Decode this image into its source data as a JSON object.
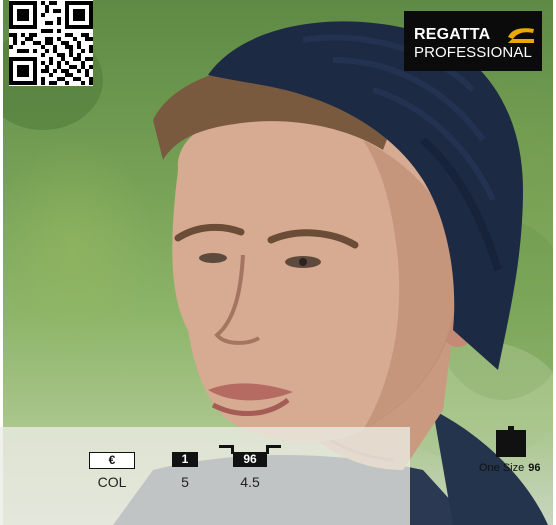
{
  "brand": {
    "line1": "REGATTA",
    "line2": "PROFESSIONAL",
    "swoosh_color": "#e8a900"
  },
  "qr_code": {
    "icon": "qr-code-icon"
  },
  "specs": {
    "currency_badge": "€",
    "currency_value": "COL",
    "pack_badge": "1",
    "pack_value": "5",
    "carton_badge": "96",
    "carton_value": "4.5"
  },
  "size": {
    "label": "One Size",
    "quantity": "96",
    "icon": "bag-icon"
  },
  "colors": {
    "beanie": "#1c2a44",
    "background": "#7ba35a"
  }
}
